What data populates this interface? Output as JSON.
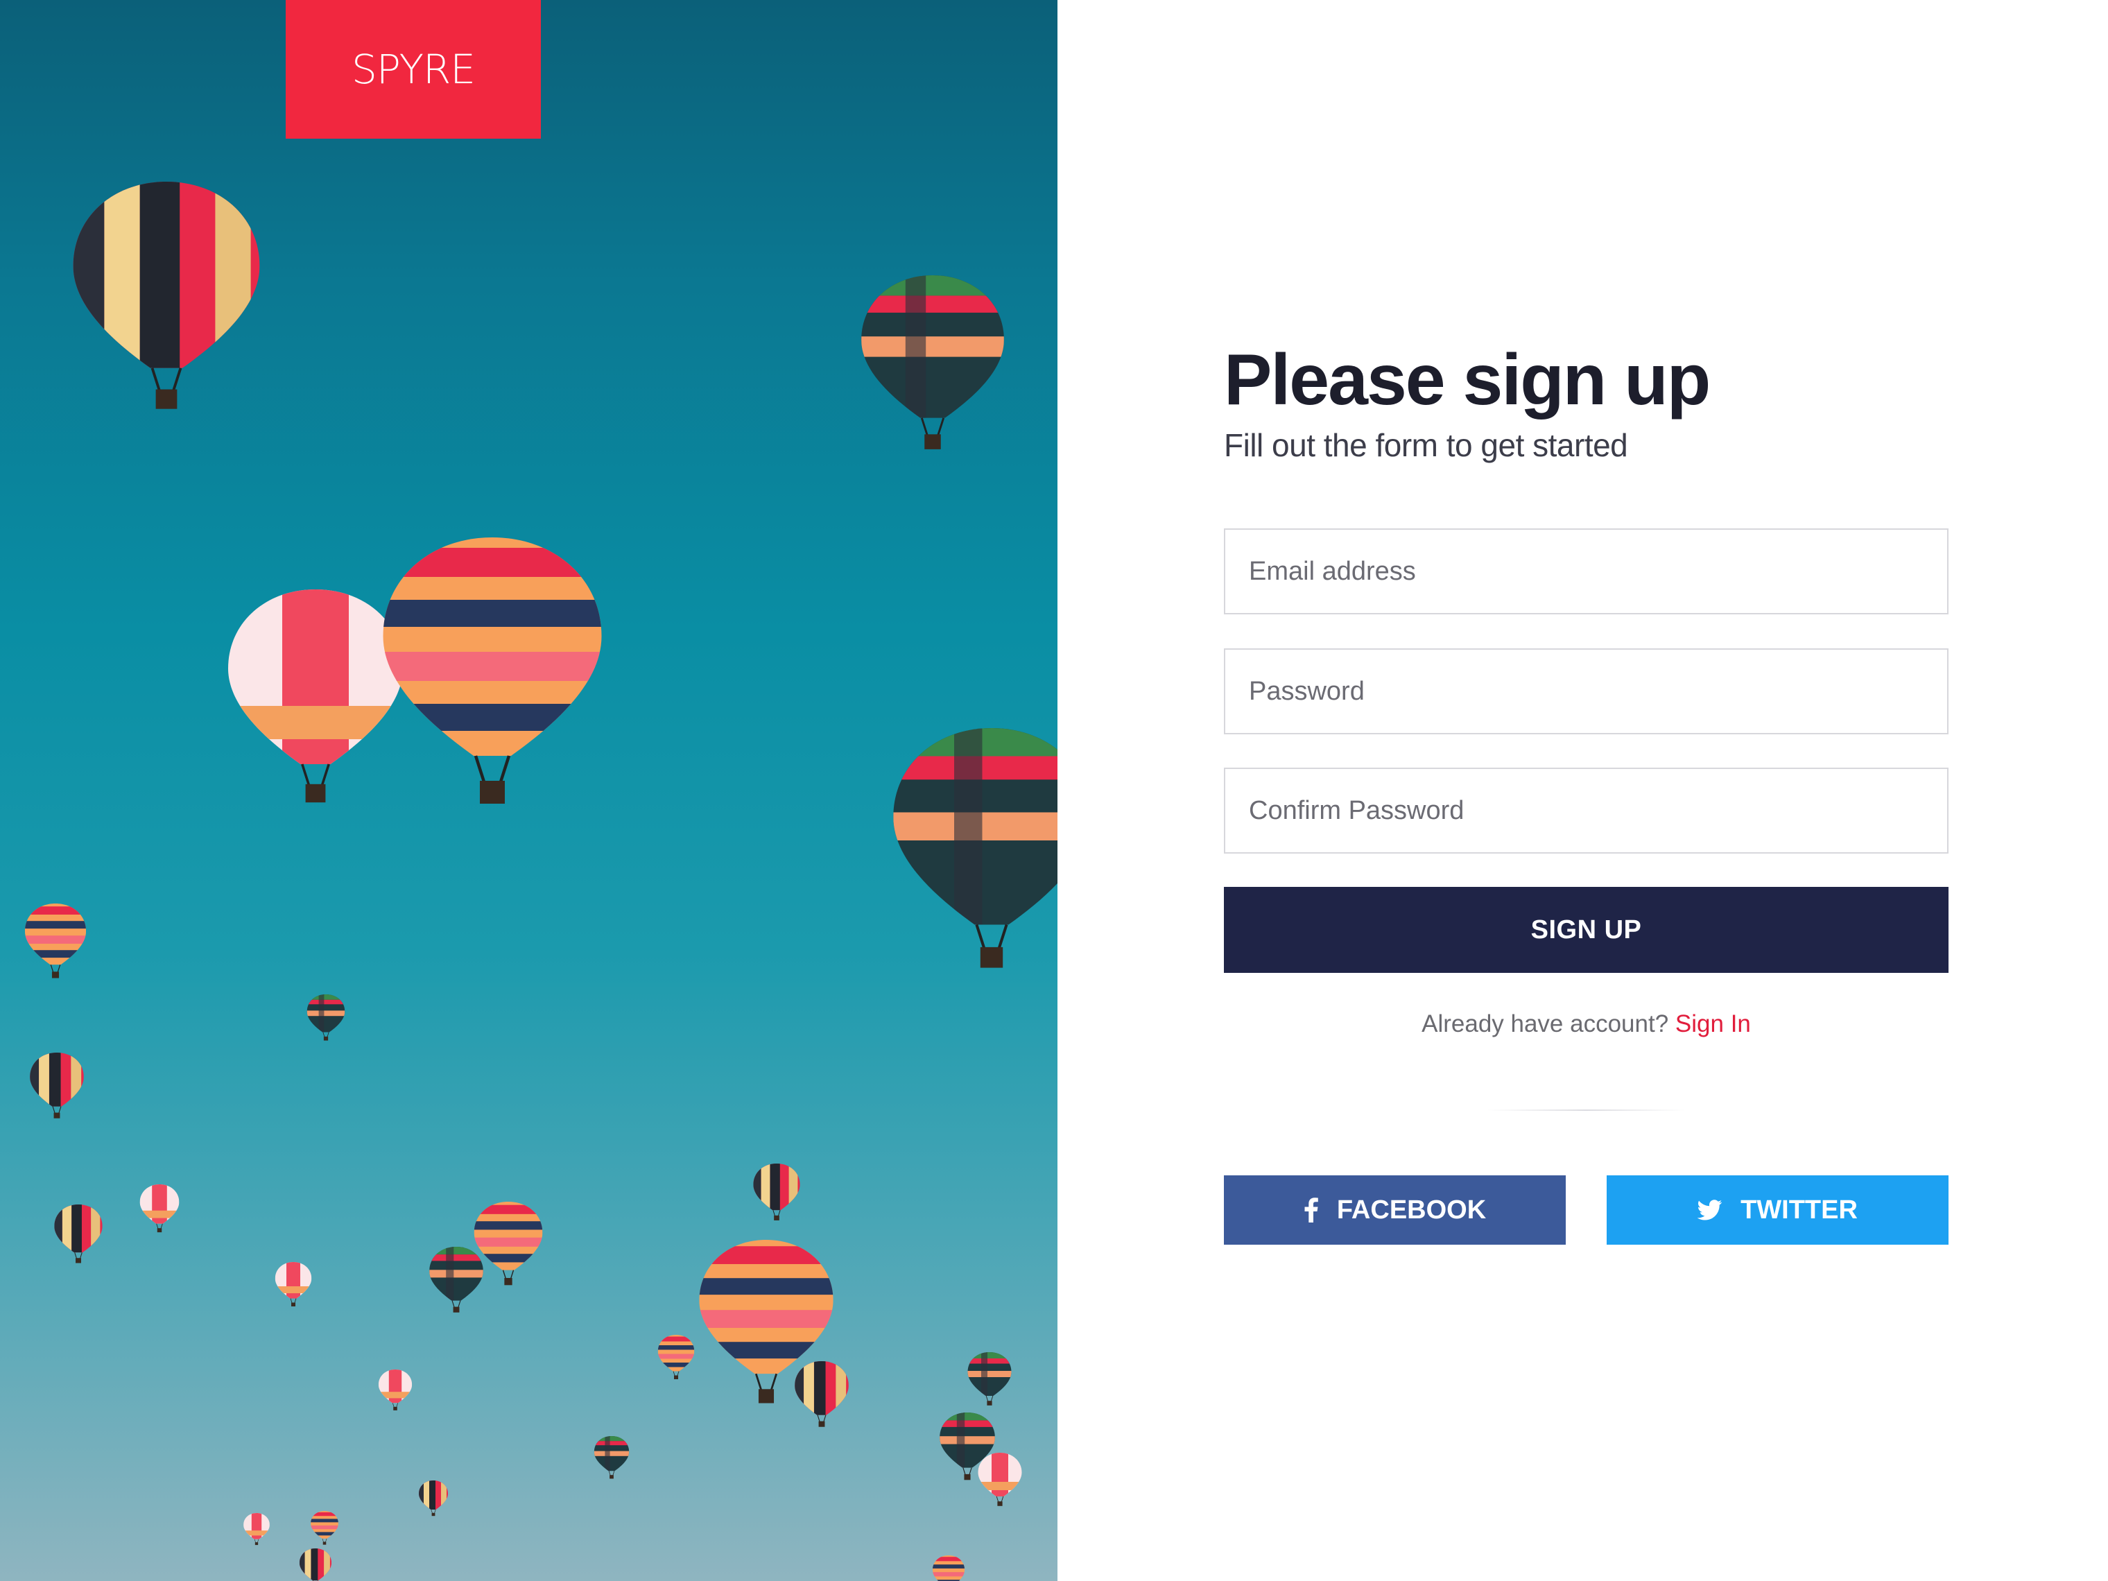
{
  "brand": {
    "logo_text": "SPYRE",
    "logo_color": "#f1273f"
  },
  "hero": {
    "image_description_icon": "hot-air-balloons-photo"
  },
  "form": {
    "title": "Please sign up",
    "subtitle": "Fill out the form to get started",
    "fields": {
      "email_placeholder": "Email address",
      "password_placeholder": "Password",
      "confirm_placeholder": "Confirm Password"
    },
    "submit_label": "SIGN UP",
    "signin_prompt": "Already have account?",
    "signin_link": "Sign In"
  },
  "social": {
    "facebook_label": "FACEBOOK",
    "facebook_icon": "facebook-icon",
    "twitter_label": "TWITTER",
    "twitter_icon": "twitter-icon"
  },
  "colors": {
    "primary_button": "#1f2447",
    "facebook": "#3c5a9a",
    "twitter": "#1da1f2",
    "link": "#e11d3c"
  }
}
